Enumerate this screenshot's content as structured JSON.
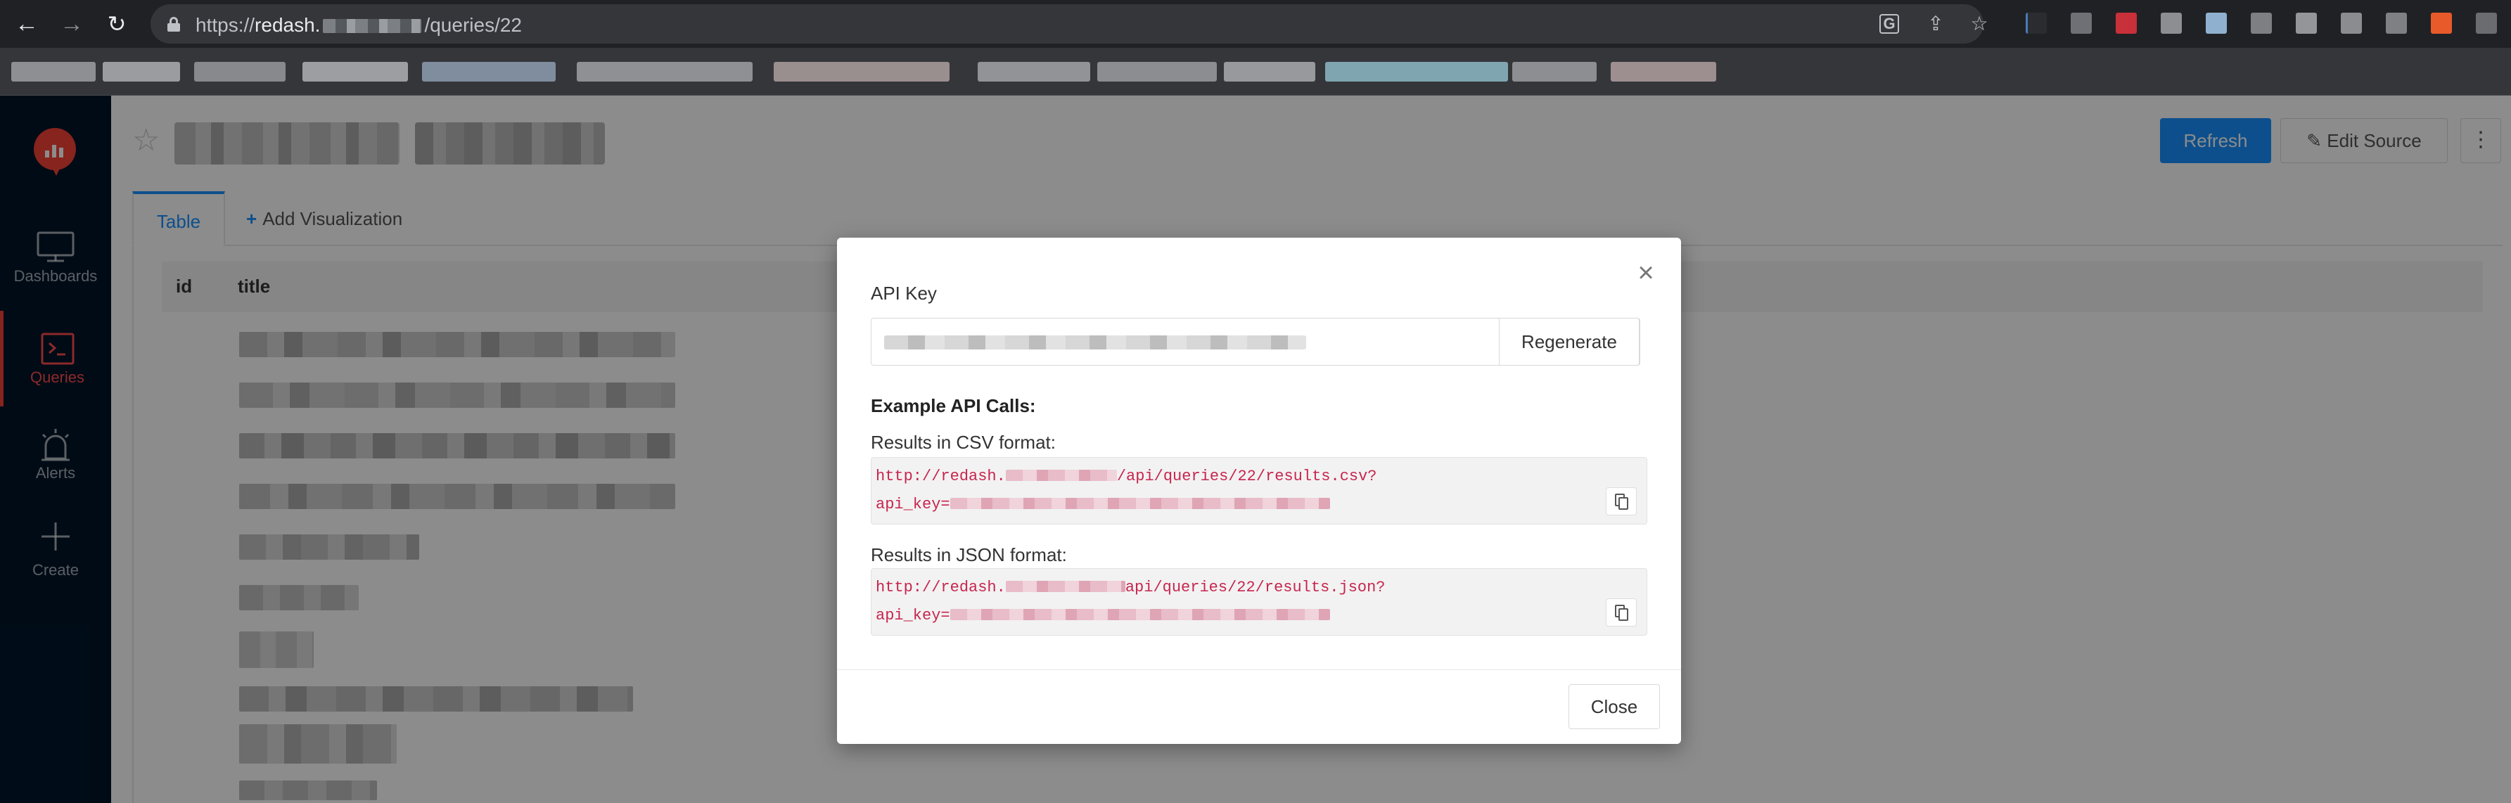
{
  "browser": {
    "url_scheme": "https://",
    "url_host": "redash.",
    "url_path": "/queries/22",
    "icons": [
      "back-arrow-icon",
      "forward-arrow-icon",
      "reload-icon",
      "lock-icon",
      "translate-icon",
      "share-icon",
      "star-icon"
    ]
  },
  "sidebar": {
    "items": [
      {
        "label": "Dashboards",
        "icon": "monitor-icon"
      },
      {
        "label": "Queries",
        "icon": "terminal-icon"
      },
      {
        "label": "Alerts",
        "icon": "siren-icon"
      },
      {
        "label": "Create",
        "icon": "plus-icon"
      }
    ]
  },
  "header": {
    "refresh_label": "Refresh",
    "edit_source_label": "Edit Source",
    "more_label": "⋮"
  },
  "tabs": {
    "table_label": "Table",
    "add_visualization_label": "Add Visualization"
  },
  "table": {
    "columns": [
      "id",
      "title"
    ]
  },
  "modal": {
    "api_key_label": "API Key",
    "regenerate_label": "Regenerate",
    "example_heading": "Example API Calls:",
    "csv_label": "Results in CSV format:",
    "csv_url_prefix": "http://redash.",
    "csv_url_suffix": "/api/queries/22/results.csv?",
    "csv_key_prefix": "api_key=",
    "json_label": "Results in JSON format:",
    "json_url_prefix": "http://redash.",
    "json_url_suffix": "api/queries/22/results.json?",
    "json_key_prefix": "api_key=",
    "close_label": "Close"
  },
  "colors": {
    "accent": "#1890ff",
    "sidebar_bg": "#001529",
    "brand_red": "#f44336",
    "code_text": "#c7254e"
  }
}
